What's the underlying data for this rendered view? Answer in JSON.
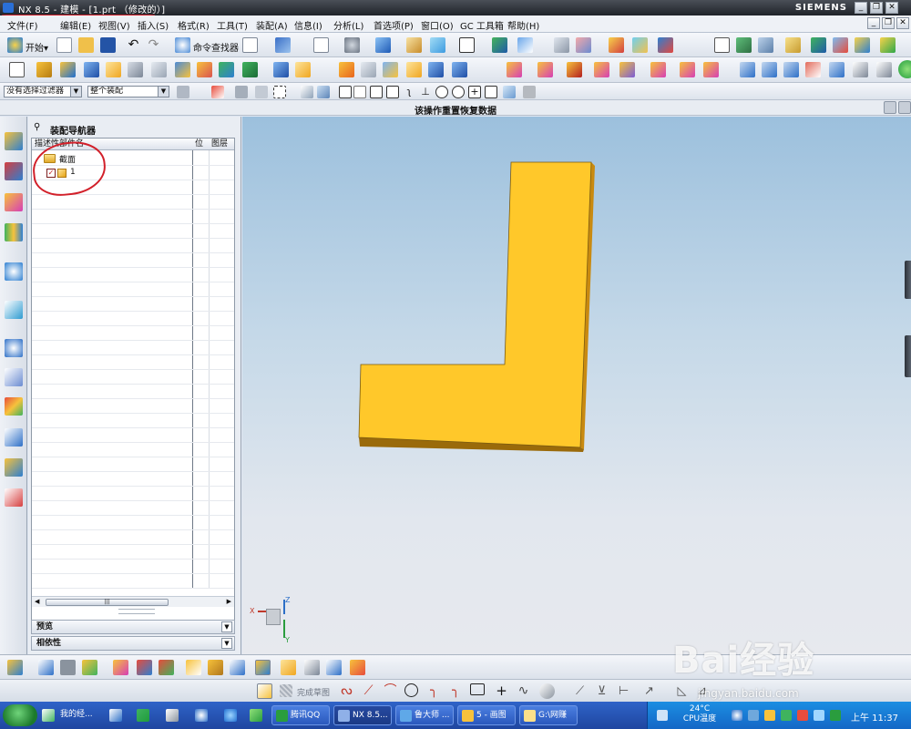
{
  "window": {
    "title": "NX 8.5 - 建模 - [1.prt （修改的）]",
    "brand": "SIEMENS",
    "controls": [
      "_",
      "❐",
      "✕"
    ]
  },
  "menubar": {
    "items": [
      "文件(F)",
      "编辑(E)",
      "视图(V)",
      "插入(S)",
      "格式(R)",
      "工具(T)",
      "装配(A)",
      "信息(I)",
      "分析(L)",
      "首选项(P)",
      "窗口(O)",
      "GC 工具箱",
      "帮助(H)"
    ],
    "doc_controls": [
      "_",
      "❐",
      "✕"
    ]
  },
  "toolbar1": {
    "start_label": "开始▾",
    "command_finder_label": "命令查找器"
  },
  "toolbar3": {
    "selection_filter": "没有选择过滤器",
    "assembly_scope": "整个装配"
  },
  "status": {
    "message": "该操作重置恢复数据"
  },
  "navigator": {
    "title": "装配导航器",
    "columns": [
      "描述性部件名",
      "位",
      "图层"
    ],
    "tree": [
      {
        "label": "截面",
        "icon": "folder-icon"
      },
      {
        "label": "1",
        "icon": "part-icon",
        "checked": true
      }
    ],
    "sections": [
      "预览",
      "相依性"
    ]
  },
  "viewport": {
    "model": "L-shaped solid body",
    "model_color": "#ffc82a",
    "triad_labels": [
      "X",
      "Y",
      "Z"
    ]
  },
  "bottom_toolbar2": {
    "sketch_done_label": "完成草图"
  },
  "taskbar": {
    "tasks": [
      "我的经...",
      "腾讯QQ",
      "NX 8.5...",
      "鲁大师 ...",
      "5 - 画图",
      "G:\\网赚"
    ],
    "temperature": "24°C",
    "temperature_label": "CPU温度",
    "clock": "上午 11:37"
  },
  "watermark": {
    "main": "Bai经验",
    "sub": "jingyan.baidu.com"
  }
}
